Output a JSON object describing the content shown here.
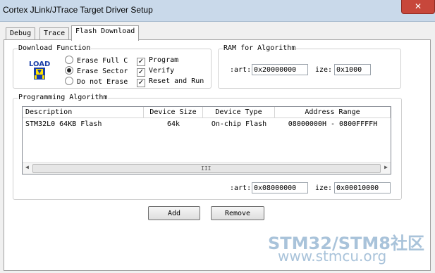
{
  "window": {
    "title": "Cortex JLink/JTrace Target Driver Setup",
    "close_glyph": "✕"
  },
  "tabs": [
    {
      "label": "Debug",
      "active": false
    },
    {
      "label": "Trace",
      "active": false
    },
    {
      "label": "Flash Download",
      "active": true
    }
  ],
  "download_function": {
    "legend": "Download Function",
    "icon_text": "LOAD",
    "options": [
      {
        "label": "Erase Full C",
        "selected": false
      },
      {
        "label": "Erase Sector",
        "selected": true
      },
      {
        "label": "Do not Erase",
        "selected": false
      }
    ],
    "checks": [
      {
        "label": "Program",
        "checked": true
      },
      {
        "label": "Verify",
        "checked": true
      },
      {
        "label": "Reset and Run",
        "checked": true
      }
    ]
  },
  "ram_for_algorithm": {
    "legend": "RAM for Algorithm",
    "start_label": ":art:",
    "start_value": "0x20000000",
    "size_label": "ize:",
    "size_value": "0x1000"
  },
  "programming_algorithm": {
    "legend": "Programming Algorithm",
    "columns": [
      "Description",
      "Device Size",
      "Device Type",
      "Address Range"
    ],
    "rows": [
      {
        "description": "STM32L0 64KB Flash",
        "size": "64k",
        "type": "On-chip Flash",
        "range": "08000000H - 0800FFFFH"
      }
    ],
    "scroll_grip": "III",
    "start_label": ":art:",
    "start_value": "0x08000000",
    "size_label": "ize:",
    "size_value": "0x00010000"
  },
  "buttons": {
    "add": "Add",
    "remove": "Remove"
  },
  "watermark": {
    "line1": "STM32/STM8社区",
    "line2": "www.stmcu.org"
  },
  "colors": {
    "title_bar": "#c9d9ea",
    "close_button": "#c7473b",
    "load_icon": "#1a3fa8",
    "watermark": "#a9c3da"
  }
}
